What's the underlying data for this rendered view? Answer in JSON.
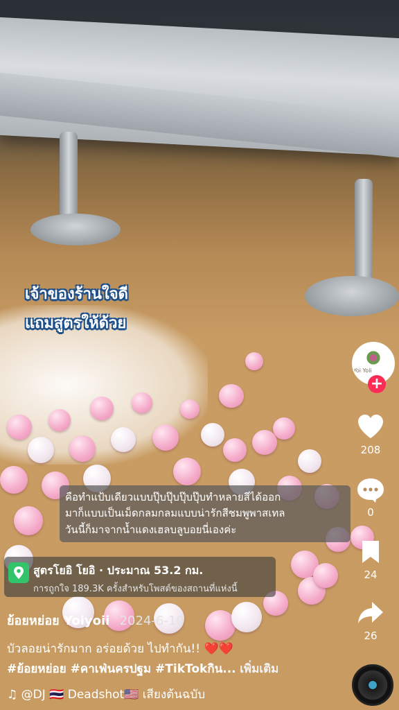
{
  "video": {
    "overlay_lines": [
      "เจ้าของร้านใจดี",
      "แถมสูตรให้ด้วย"
    ],
    "caption_lines": [
      "คือทำแป้บเดียวแบบปุ๊บปุ๊บปุ๊บปุ๊บทำหลายสีได้ออก",
      "มาก็แบบเป็นเม็ดกลมกลมแบบน่ารักสีชมพูพาสเทล",
      "วันนี้ก็มาจากน้ำแดงเฮลบลูบอยนี่เองค่ะ"
    ]
  },
  "location": {
    "title": "สูตรโยอิ โยอิ · ประมาณ 53.2 กม.",
    "subtitle": "การถูกใจ 189.3K ครั้งสำหรับโพสต์ของสถานที่แห่งนี้"
  },
  "post": {
    "author": "ย้อยหย่อย Yoiyoii",
    "date": "2024-6-10",
    "description": "บัวลอยน่ารักมาก อร่อยด้วย ไปทำกัน!!",
    "hearts": "❤️❤️",
    "hashtags": "#ย้อยหย่อย #คาเฟ่นครปฐม #TikTokกิน...",
    "more_label": "เพิ่มเติม",
    "music": "♫ @DJ 🇹🇭 Deadshot🇺🇸 เสียงต้นฉบับ"
  },
  "sidebar": {
    "avatar_label": "Yoi Yoii",
    "follow_label": "+",
    "like_count": "208",
    "comment_count": "0",
    "save_count": "24",
    "share_count": "26"
  }
}
